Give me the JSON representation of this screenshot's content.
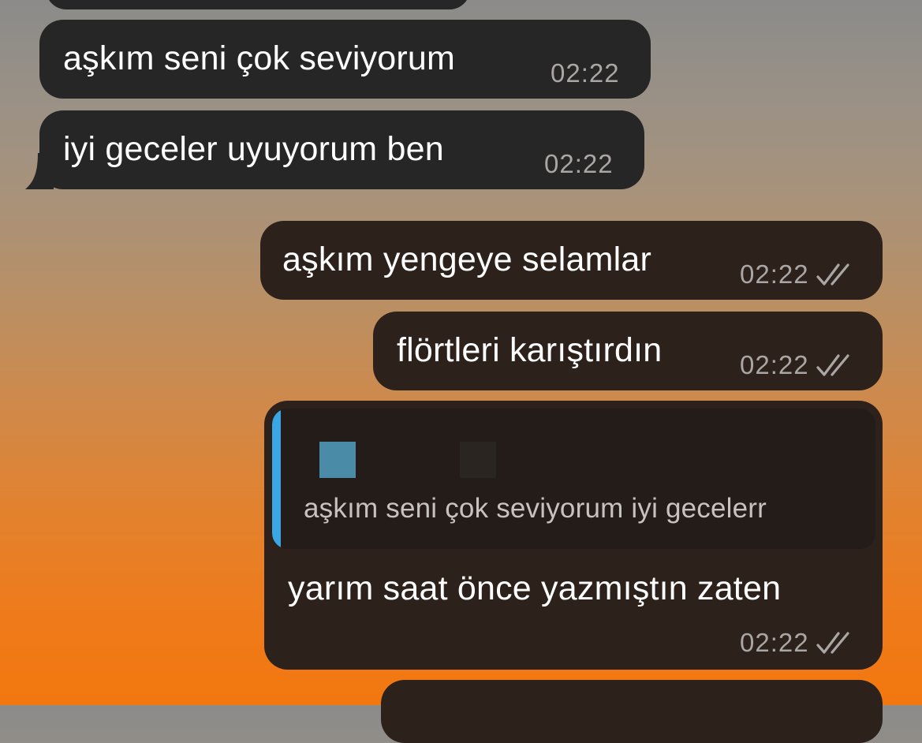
{
  "messages": [
    {
      "direction": "incoming",
      "text": "aşkım seni çok seviyorum",
      "time": "02:22"
    },
    {
      "direction": "incoming",
      "text": "iyi geceler uyuyorum ben",
      "time": "02:22"
    },
    {
      "direction": "outgoing",
      "text": "aşkım yengeye selamlar",
      "time": "02:22",
      "read": true
    },
    {
      "direction": "outgoing",
      "text": "flörtleri karıştırdın",
      "time": "02:22",
      "read": true
    },
    {
      "direction": "outgoing",
      "reply_to": {
        "text": "aşkım seni çok seviyorum iyi gecelerr"
      },
      "text": "yarım saat önce yazmıştın zaten",
      "time": "02:22",
      "read": true
    }
  ],
  "icons": {
    "read_receipt": "double-check-icon",
    "incoming_tail": "bubble-tail-icon"
  },
  "colors": {
    "incoming_bubble": "#262626",
    "outgoing_bubble": "#2d211c",
    "reply_accent": "#3aa6e3",
    "timestamp": "#a9a6a4",
    "background_top": "#8b8b8a",
    "background_bottom": "#f3770f"
  }
}
